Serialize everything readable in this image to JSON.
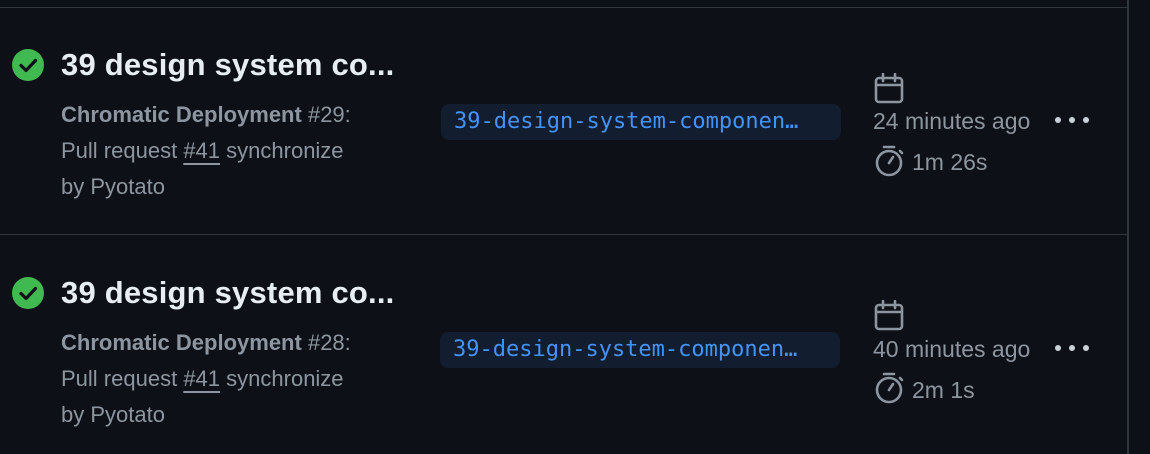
{
  "runs": [
    {
      "title": "39 design system co...",
      "workflow": "Chromatic Deployment",
      "run_number": "#29",
      "event_text": "Pull request",
      "pr_link": "#41",
      "action": "synchronize",
      "by": "by Pyotato",
      "branch": "39-design-system-componen…",
      "time_ago": "24 minutes ago",
      "duration": "1m 26s",
      "status": "success"
    },
    {
      "title": "39 design system co...",
      "workflow": "Chromatic Deployment",
      "run_number": "#28",
      "event_text": "Pull request",
      "pr_link": "#41",
      "action": "synchronize",
      "by": "by Pyotato",
      "branch": "39-design-system-componen…",
      "time_ago": "40 minutes ago",
      "duration": "2m 1s",
      "status": "success"
    }
  ],
  "colors": {
    "background": "#0d1117",
    "success": "#3fb950",
    "branch_text": "#4493f8",
    "branch_bg": "#121d2f",
    "muted": "#8d96a0"
  },
  "icons": {
    "status": "check-circle-icon",
    "date": "calendar-icon",
    "duration": "stopwatch-icon",
    "menu": "kebab-horizontal-icon"
  }
}
